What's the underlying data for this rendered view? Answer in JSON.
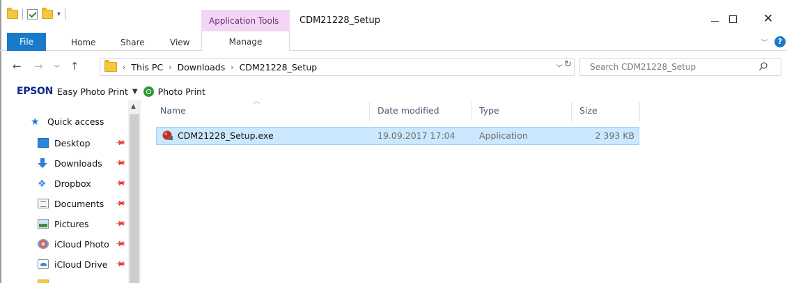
{
  "window": {
    "title": "CDM21228_Setup",
    "context_tab_group": "Application Tools"
  },
  "ribbon": {
    "tabs": [
      "File",
      "Home",
      "Share",
      "View",
      "Manage"
    ]
  },
  "address": {
    "crumbs": [
      "This PC",
      "Downloads",
      "CDM21228_Setup"
    ]
  },
  "search": {
    "placeholder": "Search CDM21228_Setup"
  },
  "epson": {
    "brand": "EPSON",
    "product": "Easy Photo Print",
    "photo_print": "Photo Print"
  },
  "nav": {
    "items": [
      {
        "label": "Quick access",
        "icon": "star-icon"
      },
      {
        "label": "Desktop",
        "icon": "desktop-icon"
      },
      {
        "label": "Downloads",
        "icon": "download-icon"
      },
      {
        "label": "Dropbox",
        "icon": "dropbox-icon"
      },
      {
        "label": "Documents",
        "icon": "documents-icon"
      },
      {
        "label": "Pictures",
        "icon": "pictures-icon"
      },
      {
        "label": "iCloud Photo",
        "icon": "icloud-photo-icon"
      },
      {
        "label": "iCloud Drive",
        "icon": "icloud-drive-icon"
      }
    ]
  },
  "files": {
    "columns": [
      "Name",
      "Date modified",
      "Type",
      "Size"
    ],
    "rows": [
      {
        "name": "CDM21228_Setup.exe",
        "date": "19.09.2017 17:04",
        "type": "Application",
        "size": "2 393 KB"
      }
    ]
  },
  "colors": {
    "accent": "#1979ca",
    "selection": "#cce8ff",
    "context_tab": "#f3d6f3"
  }
}
